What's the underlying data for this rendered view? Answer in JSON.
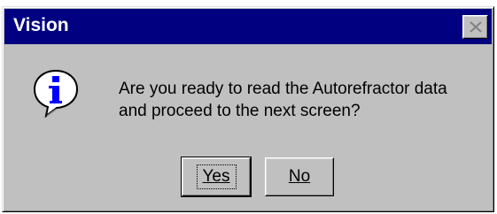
{
  "window": {
    "title": "Vision",
    "close_icon": "close-icon"
  },
  "dialog": {
    "icon": "info-icon",
    "message_line1": "Are you ready to read the Autorefractor data",
    "message_line2": "and proceed to the next screen?"
  },
  "buttons": {
    "yes_label": "Yes",
    "no_label": "No",
    "default_button": "Yes"
  },
  "colors": {
    "titlebar": "#000080",
    "dialog_bg": "#c0c0c0",
    "icon_blue": "#0000ff"
  }
}
